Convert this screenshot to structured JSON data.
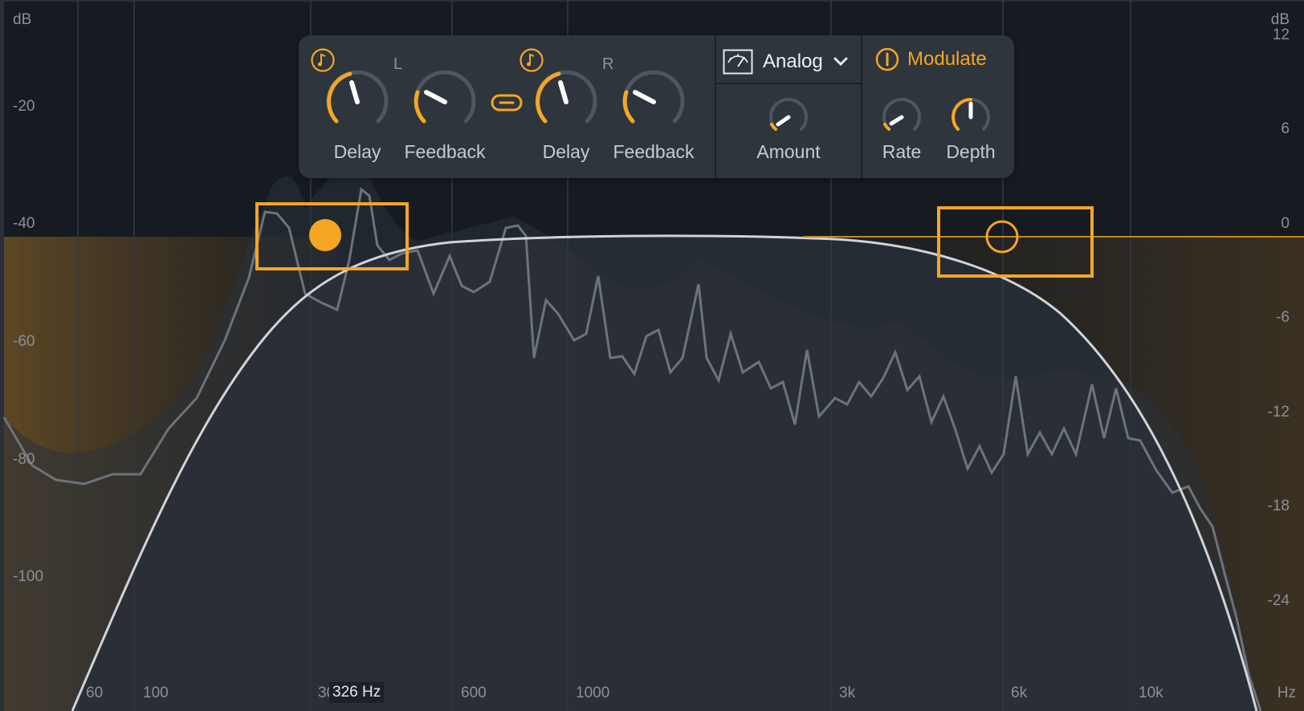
{
  "axis": {
    "left_unit": "dB",
    "left_ticks": [
      "-20",
      "-40",
      "-60",
      "-80",
      "-100"
    ],
    "right_unit": "dB",
    "right_ticks": [
      "12",
      "6",
      "0",
      "-6",
      "-12",
      "-18",
      "-24"
    ],
    "freq_unit": "Hz",
    "freq_ticks": [
      "60",
      "100",
      "30",
      "600",
      "1000",
      "3k",
      "6k",
      "10k"
    ]
  },
  "cursor": {
    "readout": "326 Hz"
  },
  "colors": {
    "accent": "#f5a623",
    "background": "#1b2026",
    "panel": "#2e353c",
    "curve": "#cfd3d8"
  },
  "panel": {
    "left": {
      "channel": "L",
      "sync_icon": "note-icon",
      "delay_label": "Delay",
      "feedback_label": "Feedback"
    },
    "link_icon": "link-icon",
    "right": {
      "channel": "R",
      "sync_icon": "note-icon",
      "delay_label": "Delay",
      "feedback_label": "Feedback"
    },
    "mode": {
      "icon": "analog-meter-icon",
      "selected": "Analog",
      "dropdown_icon": "chevron-down-icon",
      "amount_label": "Amount"
    },
    "modulate": {
      "power_icon": "power-icon",
      "label": "Modulate",
      "enabled": true,
      "rate_label": "Rate",
      "depth_label": "Depth"
    }
  }
}
